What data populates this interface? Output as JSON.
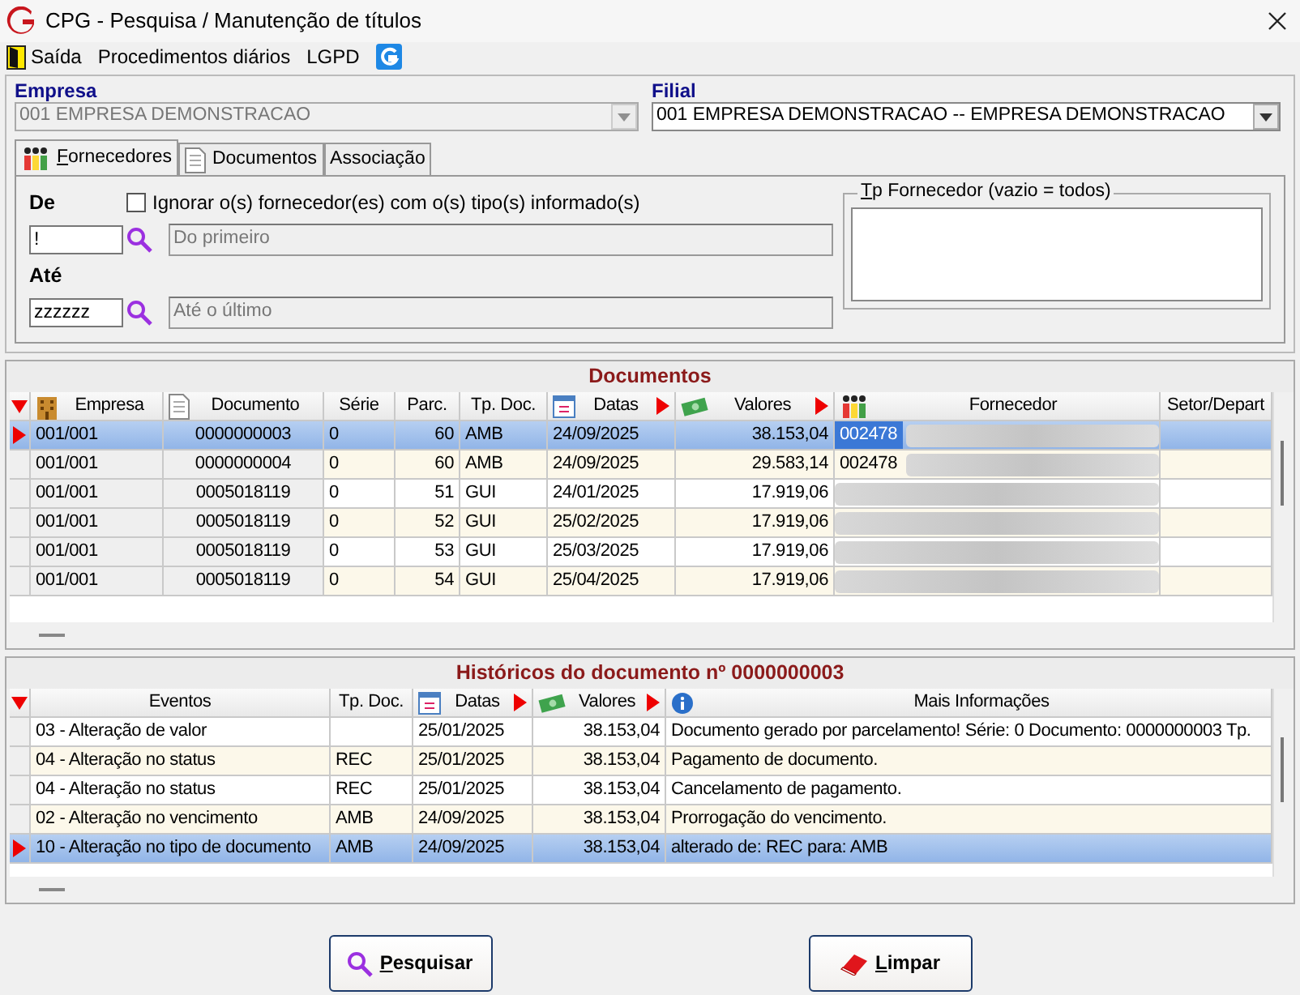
{
  "window": {
    "title": "CPG - Pesquisa / Manutenção de títulos"
  },
  "menu": [
    {
      "label": "Saída"
    },
    {
      "label": "Procedimentos diários"
    },
    {
      "label": "LGPD"
    }
  ],
  "empresa": {
    "label": "Empresa",
    "value": "001 EMPRESA DEMONSTRACAO",
    "disabled": true
  },
  "filial": {
    "label": "Filial",
    "value": "001 EMPRESA DEMONSTRACAO -- EMPRESA DEMONSTRACAO",
    "disabled": false
  },
  "tabs": [
    {
      "label": "Fornecedores",
      "selected": true
    },
    {
      "label": "Documentos",
      "selected": false
    },
    {
      "label": "Associação",
      "selected": false
    }
  ],
  "filter": {
    "ignore_checkbox": {
      "label": "Ignorar o(s) fornecedor(es) com o(s) tipo(s) informado(s)",
      "checked": false
    },
    "from": {
      "label": "De",
      "value": "!",
      "description": "Do primeiro"
    },
    "to": {
      "label": "Até",
      "value": "zzzzzz",
      "description": "Até o último"
    },
    "type_group": {
      "title": "Tp Fornecedor (vazio = todos)"
    }
  },
  "documents": {
    "title": "Documentos",
    "columns": [
      {
        "label": "Empresa"
      },
      {
        "label": "Documento"
      },
      {
        "label": "Série"
      },
      {
        "label": "Parc."
      },
      {
        "label": "Tp. Doc."
      },
      {
        "label": "Datas",
        "sorted": true
      },
      {
        "label": "Valores",
        "sorted": true
      },
      {
        "label": "Fornecedor"
      },
      {
        "label": "Setor/Depart"
      }
    ],
    "rows": [
      {
        "selected": true,
        "cells": [
          "001/001",
          "0000000003",
          "0",
          "60",
          "AMB",
          "24/09/2025",
          "38.153,04",
          "002478"
        ]
      },
      {
        "selected": false,
        "cells": [
          "001/001",
          "0000000004",
          "0",
          "60",
          "AMB",
          "24/09/2025",
          "29.583,14",
          "002478"
        ]
      },
      {
        "selected": false,
        "cells": [
          "001/001",
          "0005018119",
          "0",
          "51",
          "GUI",
          "24/01/2025",
          "17.919,06"
        ]
      },
      {
        "selected": false,
        "cells": [
          "001/001",
          "0005018119",
          "0",
          "52",
          "GUI",
          "25/02/2025",
          "17.919,06"
        ]
      },
      {
        "selected": false,
        "cells": [
          "001/001",
          "0005018119",
          "0",
          "53",
          "GUI",
          "25/03/2025",
          "17.919,06"
        ]
      },
      {
        "selected": false,
        "cells": [
          "001/001",
          "0005018119",
          "0",
          "54",
          "GUI",
          "25/04/2025",
          "17.919,06"
        ]
      }
    ]
  },
  "history": {
    "title": "Históricos do documento nº 0000000003",
    "columns": [
      {
        "label": "Eventos"
      },
      {
        "label": "Tp. Doc."
      },
      {
        "label": "Datas",
        "sorted": true
      },
      {
        "label": "Valores",
        "sorted": true
      },
      {
        "label": "Mais Informações"
      }
    ],
    "rows": [
      {
        "selected": false,
        "cells": [
          "03 - Alteração de valor",
          "",
          "25/01/2025",
          "38.153,04",
          "Documento gerado por parcelamento! Série: 0 Documento: 0000000003 Tp."
        ]
      },
      {
        "selected": false,
        "cells": [
          "04 - Alteração no status",
          "REC",
          "25/01/2025",
          "38.153,04",
          "Pagamento de documento."
        ]
      },
      {
        "selected": false,
        "cells": [
          "04 - Alteração no status",
          "REC",
          "25/01/2025",
          "38.153,04",
          "Cancelamento de pagamento."
        ]
      },
      {
        "selected": false,
        "cells": [
          "02 - Alteração no vencimento",
          "AMB",
          "24/09/2025",
          "38.153,04",
          "Prorrogação do vencimento."
        ]
      },
      {
        "selected": true,
        "cells": [
          "10 - Alteração no tipo de documento",
          "AMB",
          "24/09/2025",
          "38.153,04",
          "alterado de: REC para: AMB"
        ]
      }
    ]
  },
  "buttons": [
    {
      "label": "Pesquisar"
    },
    {
      "label": "Limpar"
    }
  ]
}
